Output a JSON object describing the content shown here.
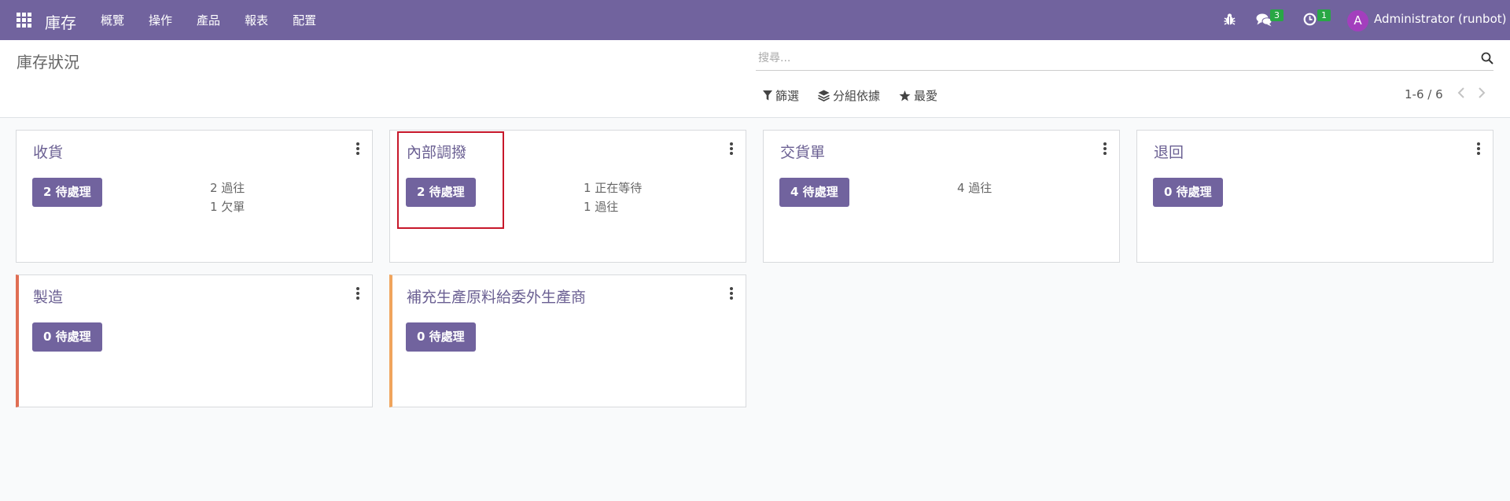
{
  "navbar": {
    "app_name": "庫存",
    "menu": [
      "概覽",
      "操作",
      "產品",
      "報表",
      "配置"
    ],
    "systray": {
      "debug_icon": "bug-icon",
      "messages_icon": "chat-icon",
      "messages_count": "3",
      "activities_icon": "clock-icon",
      "activities_count": "1",
      "user_initial": "A",
      "user_name": "Administrator (runbot)"
    },
    "colors": {
      "navbar_bg": "#71639e",
      "badge": "#28a745",
      "avatar": "#a33fbd"
    }
  },
  "control_panel": {
    "title": "庫存狀況",
    "search_placeholder": "搜尋...",
    "filter_label": "篩選",
    "group_by_label": "分組依據",
    "favorites_label": "最愛",
    "pager": "1-6 / 6"
  },
  "cards": [
    {
      "title": "收貨",
      "button": "2 待處理",
      "stats": [
        "2 過往",
        "1 欠單"
      ]
    },
    {
      "title": "內部調撥",
      "button": "2 待處理",
      "stats": [
        "1 正在等待",
        "1 過往"
      ]
    },
    {
      "title": "交貨單",
      "button": "4 待處理",
      "stats": [
        "4 過往"
      ]
    },
    {
      "title": "退回",
      "button": "0 待處理",
      "stats": []
    },
    {
      "title": "製造",
      "button": "0 待處理",
      "stats": [],
      "stripe_color": "#e06e54"
    },
    {
      "title": "補充生產原料給委外生產商",
      "button": "0 待處理",
      "stats": [],
      "stripe_color": "#f0a45c"
    }
  ],
  "colors": {
    "primary": "#71639e",
    "card_title": "#6a5f92",
    "highlight": "#c7182a"
  }
}
